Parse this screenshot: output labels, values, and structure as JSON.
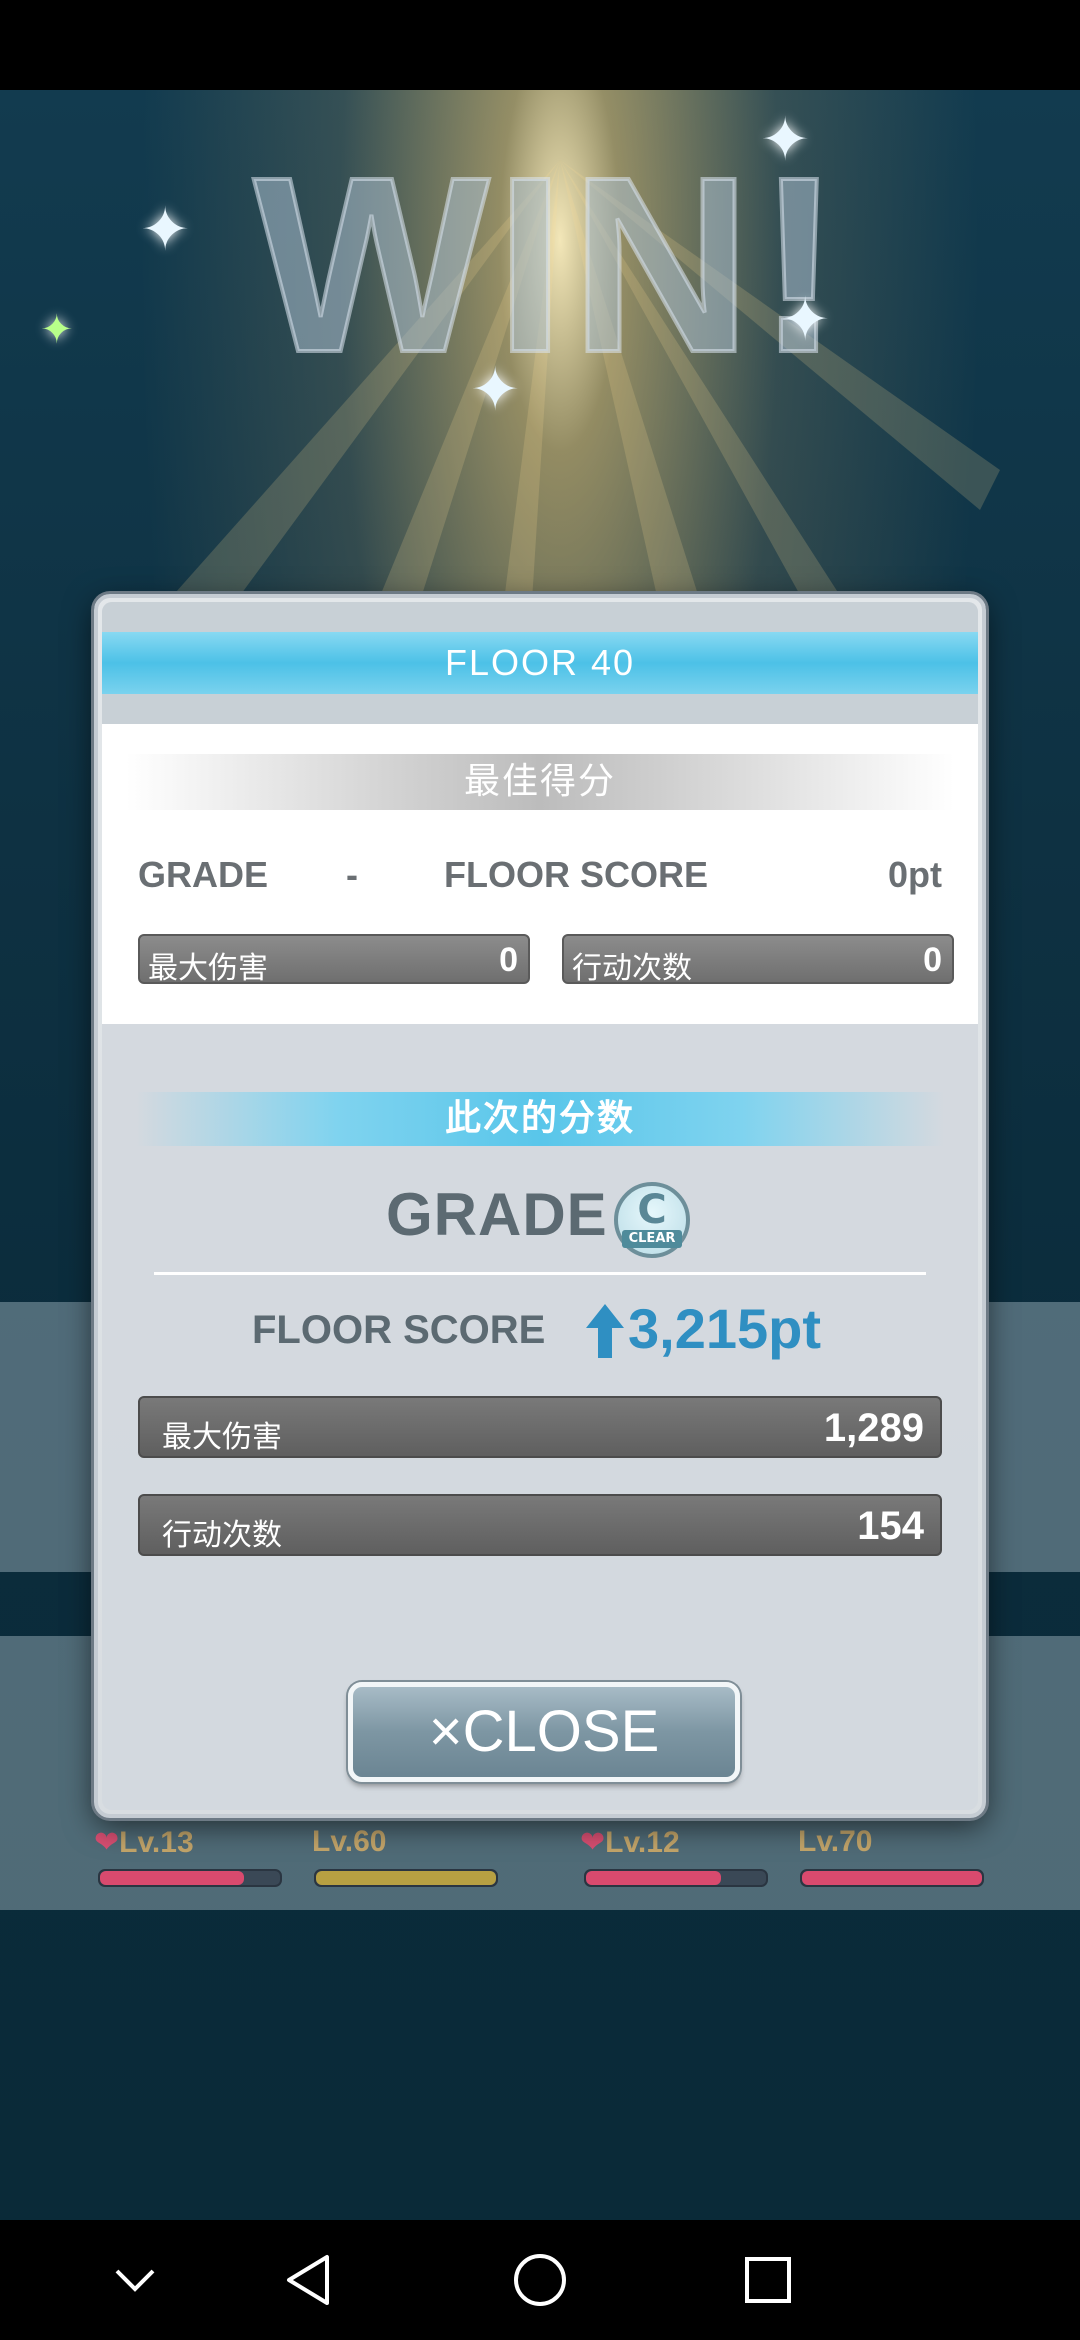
{
  "scene": {
    "win_text": "WIN!"
  },
  "team": {
    "members": [
      {
        "level": "Lv.13",
        "hp_fraction": 0.8,
        "hp_color": "#d94a6e",
        "heart": true
      },
      {
        "level": "Lv.60",
        "hp_fraction": 1.0,
        "hp_color": "#b7a042",
        "heart": false
      },
      {
        "level": "Lv.12",
        "hp_fraction": 0.75,
        "hp_color": "#d94a6e",
        "heart": true
      },
      {
        "level": "Lv.70",
        "hp_fraction": 1.0,
        "hp_color": "#d94a6e",
        "heart": false
      }
    ]
  },
  "dialog": {
    "floor_title": "FLOOR 40",
    "best": {
      "title": "最佳得分",
      "grade_label": "GRADE",
      "grade_value": "-",
      "floor_score_label": "FLOOR SCORE",
      "floor_score_value": "0pt",
      "max_damage_label": "最大伤害",
      "max_damage_value": "0",
      "actions_label": "行动次数",
      "actions_value": "0"
    },
    "current": {
      "title": "此次的分数",
      "grade_label": "GRADE",
      "grade_badge_letter": "C",
      "grade_badge_text": "CLEAR",
      "floor_score_label": "FLOOR SCORE",
      "floor_score_value": "3,215pt",
      "max_damage_label": "最大伤害",
      "max_damage_value": "1,289",
      "actions_label": "行动次数",
      "actions_value": "154"
    },
    "close_label": "×CLOSE"
  },
  "colors": {
    "accent_blue": "#4cc1e7",
    "score_blue": "#2f8fc2"
  },
  "nav": {
    "icons": [
      "chevron-down-icon",
      "back-icon",
      "home-icon",
      "recents-icon"
    ]
  }
}
